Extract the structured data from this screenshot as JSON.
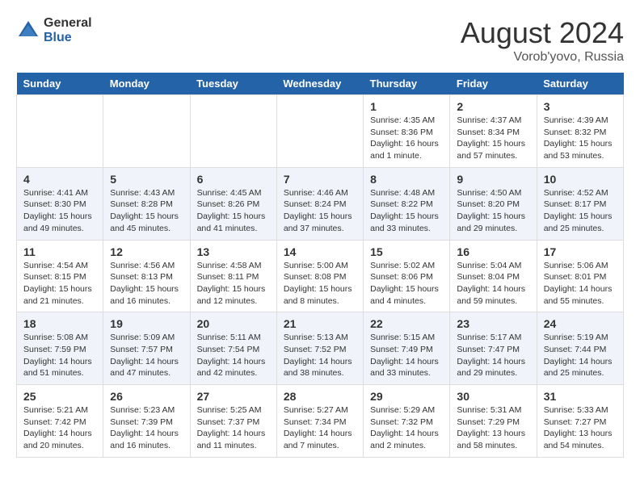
{
  "header": {
    "logo_general": "General",
    "logo_blue": "Blue",
    "month_year": "August 2024",
    "location": "Vorob'yovo, Russia"
  },
  "weekdays": [
    "Sunday",
    "Monday",
    "Tuesday",
    "Wednesday",
    "Thursday",
    "Friday",
    "Saturday"
  ],
  "weeks": [
    [
      {
        "day": "",
        "info": ""
      },
      {
        "day": "",
        "info": ""
      },
      {
        "day": "",
        "info": ""
      },
      {
        "day": "",
        "info": ""
      },
      {
        "day": "1",
        "info": "Sunrise: 4:35 AM\nSunset: 8:36 PM\nDaylight: 16 hours\nand 1 minute."
      },
      {
        "day": "2",
        "info": "Sunrise: 4:37 AM\nSunset: 8:34 PM\nDaylight: 15 hours\nand 57 minutes."
      },
      {
        "day": "3",
        "info": "Sunrise: 4:39 AM\nSunset: 8:32 PM\nDaylight: 15 hours\nand 53 minutes."
      }
    ],
    [
      {
        "day": "4",
        "info": "Sunrise: 4:41 AM\nSunset: 8:30 PM\nDaylight: 15 hours\nand 49 minutes."
      },
      {
        "day": "5",
        "info": "Sunrise: 4:43 AM\nSunset: 8:28 PM\nDaylight: 15 hours\nand 45 minutes."
      },
      {
        "day": "6",
        "info": "Sunrise: 4:45 AM\nSunset: 8:26 PM\nDaylight: 15 hours\nand 41 minutes."
      },
      {
        "day": "7",
        "info": "Sunrise: 4:46 AM\nSunset: 8:24 PM\nDaylight: 15 hours\nand 37 minutes."
      },
      {
        "day": "8",
        "info": "Sunrise: 4:48 AM\nSunset: 8:22 PM\nDaylight: 15 hours\nand 33 minutes."
      },
      {
        "day": "9",
        "info": "Sunrise: 4:50 AM\nSunset: 8:20 PM\nDaylight: 15 hours\nand 29 minutes."
      },
      {
        "day": "10",
        "info": "Sunrise: 4:52 AM\nSunset: 8:17 PM\nDaylight: 15 hours\nand 25 minutes."
      }
    ],
    [
      {
        "day": "11",
        "info": "Sunrise: 4:54 AM\nSunset: 8:15 PM\nDaylight: 15 hours\nand 21 minutes."
      },
      {
        "day": "12",
        "info": "Sunrise: 4:56 AM\nSunset: 8:13 PM\nDaylight: 15 hours\nand 16 minutes."
      },
      {
        "day": "13",
        "info": "Sunrise: 4:58 AM\nSunset: 8:11 PM\nDaylight: 15 hours\nand 12 minutes."
      },
      {
        "day": "14",
        "info": "Sunrise: 5:00 AM\nSunset: 8:08 PM\nDaylight: 15 hours\nand 8 minutes."
      },
      {
        "day": "15",
        "info": "Sunrise: 5:02 AM\nSunset: 8:06 PM\nDaylight: 15 hours\nand 4 minutes."
      },
      {
        "day": "16",
        "info": "Sunrise: 5:04 AM\nSunset: 8:04 PM\nDaylight: 14 hours\nand 59 minutes."
      },
      {
        "day": "17",
        "info": "Sunrise: 5:06 AM\nSunset: 8:01 PM\nDaylight: 14 hours\nand 55 minutes."
      }
    ],
    [
      {
        "day": "18",
        "info": "Sunrise: 5:08 AM\nSunset: 7:59 PM\nDaylight: 14 hours\nand 51 minutes."
      },
      {
        "day": "19",
        "info": "Sunrise: 5:09 AM\nSunset: 7:57 PM\nDaylight: 14 hours\nand 47 minutes."
      },
      {
        "day": "20",
        "info": "Sunrise: 5:11 AM\nSunset: 7:54 PM\nDaylight: 14 hours\nand 42 minutes."
      },
      {
        "day": "21",
        "info": "Sunrise: 5:13 AM\nSunset: 7:52 PM\nDaylight: 14 hours\nand 38 minutes."
      },
      {
        "day": "22",
        "info": "Sunrise: 5:15 AM\nSunset: 7:49 PM\nDaylight: 14 hours\nand 33 minutes."
      },
      {
        "day": "23",
        "info": "Sunrise: 5:17 AM\nSunset: 7:47 PM\nDaylight: 14 hours\nand 29 minutes."
      },
      {
        "day": "24",
        "info": "Sunrise: 5:19 AM\nSunset: 7:44 PM\nDaylight: 14 hours\nand 25 minutes."
      }
    ],
    [
      {
        "day": "25",
        "info": "Sunrise: 5:21 AM\nSunset: 7:42 PM\nDaylight: 14 hours\nand 20 minutes."
      },
      {
        "day": "26",
        "info": "Sunrise: 5:23 AM\nSunset: 7:39 PM\nDaylight: 14 hours\nand 16 minutes."
      },
      {
        "day": "27",
        "info": "Sunrise: 5:25 AM\nSunset: 7:37 PM\nDaylight: 14 hours\nand 11 minutes."
      },
      {
        "day": "28",
        "info": "Sunrise: 5:27 AM\nSunset: 7:34 PM\nDaylight: 14 hours\nand 7 minutes."
      },
      {
        "day": "29",
        "info": "Sunrise: 5:29 AM\nSunset: 7:32 PM\nDaylight: 14 hours\nand 2 minutes."
      },
      {
        "day": "30",
        "info": "Sunrise: 5:31 AM\nSunset: 7:29 PM\nDaylight: 13 hours\nand 58 minutes."
      },
      {
        "day": "31",
        "info": "Sunrise: 5:33 AM\nSunset: 7:27 PM\nDaylight: 13 hours\nand 54 minutes."
      }
    ]
  ]
}
